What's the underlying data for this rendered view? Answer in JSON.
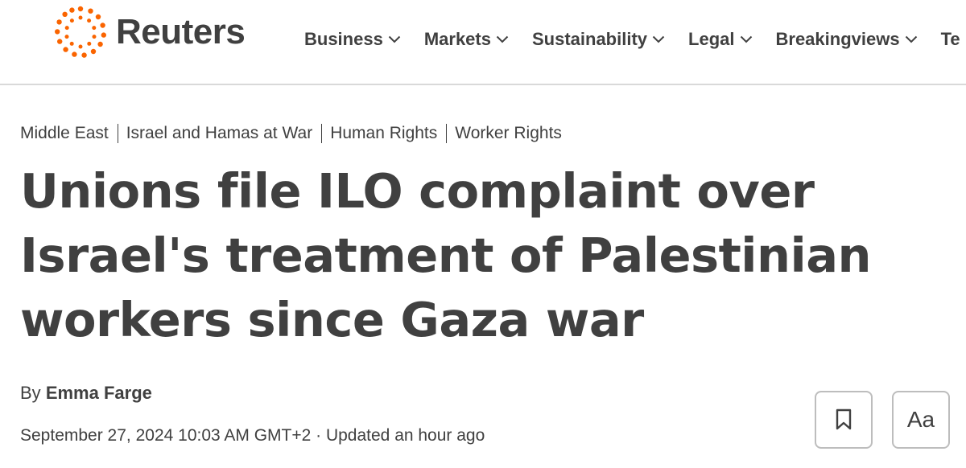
{
  "brand": {
    "name": "Reuters",
    "logo_icon": "reuters-dot-circle-icon",
    "accent_color": "#fa6400"
  },
  "nav": {
    "items": [
      {
        "label": "Business",
        "icon": "chevron-down-icon"
      },
      {
        "label": "Markets",
        "icon": "chevron-down-icon"
      },
      {
        "label": "Sustainability",
        "icon": "chevron-down-icon"
      },
      {
        "label": "Legal",
        "icon": "chevron-down-icon"
      },
      {
        "label": "Breakingviews",
        "icon": "chevron-down-icon"
      },
      {
        "label": "Te"
      }
    ]
  },
  "breadcrumb": {
    "items": [
      "Middle East",
      "Israel and Hamas at War",
      "Human Rights",
      "Worker Rights"
    ]
  },
  "article": {
    "headline": "Unions file ILO complaint over Israel's treatment of Palestinian workers since Gaza war",
    "byline_prefix": "By",
    "author": "Emma Farge",
    "dateline": "September 27, 2024 10:03 AM GMT+2 · Updated an hour ago"
  },
  "tools": {
    "bookmark_icon": "bookmark-icon",
    "text_size_label": "Aa"
  },
  "colors": {
    "text": "#404040",
    "divider": "#d9d9d9",
    "button_border": "#bdbdbd"
  }
}
